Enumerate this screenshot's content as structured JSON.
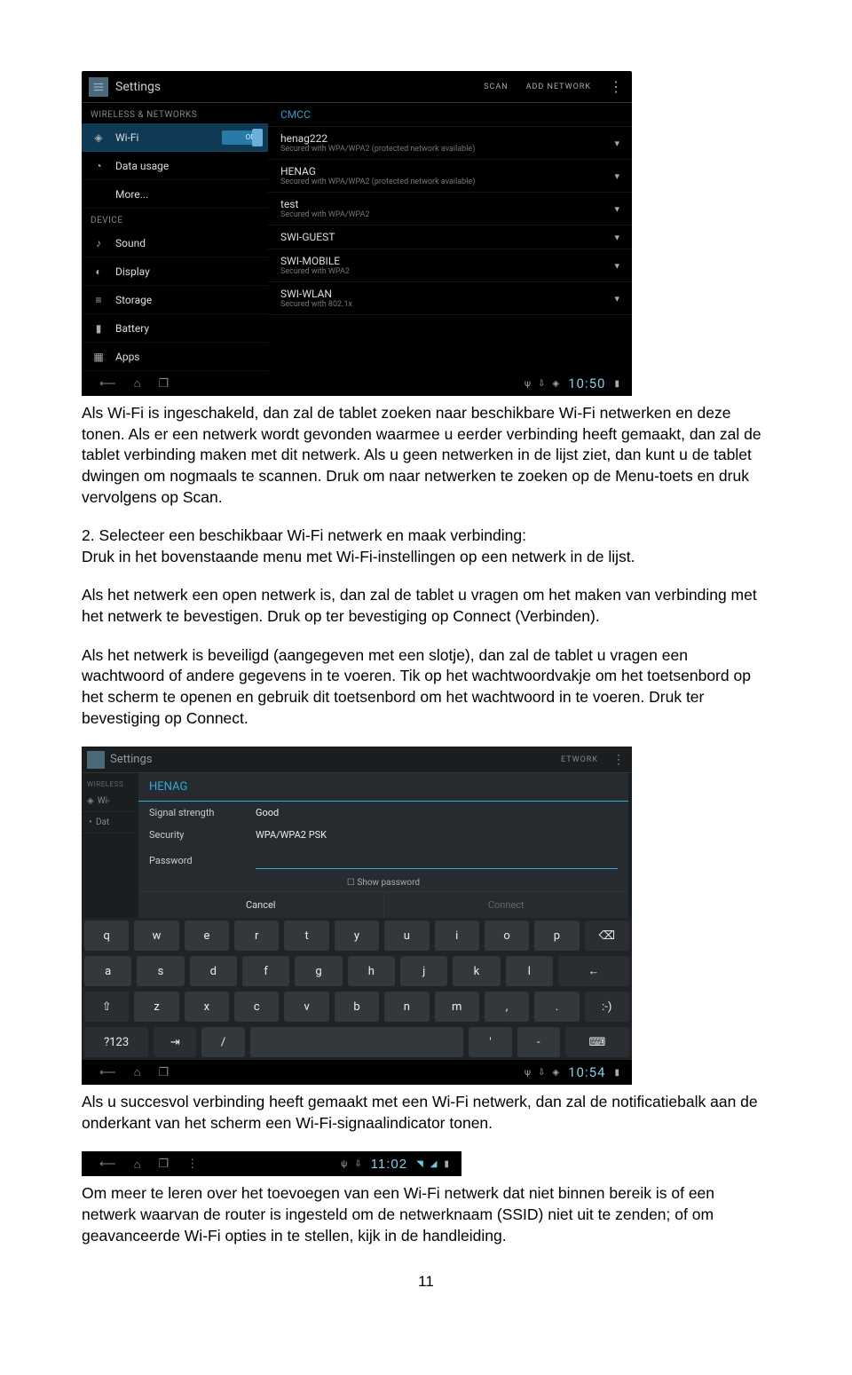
{
  "shot1": {
    "title": "Settings",
    "actions": {
      "scan": "SCAN",
      "add": "ADD NETWORK"
    },
    "cat_wn": "WIRELESS & NETWORKS",
    "cat_dev": "DEVICE",
    "wifi_label": "Wi-Fi",
    "toggle": "ON",
    "data_usage": "Data usage",
    "more": "More...",
    "sound": "Sound",
    "display": "Display",
    "storage": "Storage",
    "battery": "Battery",
    "apps": "Apps",
    "nets": [
      {
        "n": "CMCC",
        "s": ""
      },
      {
        "n": "henag222",
        "s": "Secured with WPA/WPA2 (protected network available)"
      },
      {
        "n": "HENAG",
        "s": "Secured with WPA/WPA2 (protected network available)"
      },
      {
        "n": "test",
        "s": "Secured with WPA/WPA2"
      },
      {
        "n": "SWI-GUEST",
        "s": ""
      },
      {
        "n": "SWI-MOBILE",
        "s": "Secured with WPA2"
      },
      {
        "n": "SWI-WLAN",
        "s": "Secured with 802.1x"
      }
    ],
    "clock": "10:50"
  },
  "shot2": {
    "title": "Settings",
    "rbtn": "ETWORK",
    "cat": "WIRELESS",
    "side_wifi": "Wi-",
    "side_data": "Dat",
    "dialog": {
      "title": "HENAG",
      "strength_lbl": "Signal strength",
      "strength_val": "Good",
      "security_lbl": "Security",
      "security_val": "WPA/WPA2 PSK",
      "password_lbl": "Password",
      "showpw": "Show password",
      "cancel": "Cancel",
      "connect": "Connect"
    },
    "keys_r1": [
      "q",
      "w",
      "e",
      "r",
      "t",
      "y",
      "u",
      "i",
      "o",
      "p",
      "⌫"
    ],
    "keys_r2": [
      "a",
      "s",
      "d",
      "f",
      "g",
      "h",
      "j",
      "k",
      "l",
      "←"
    ],
    "keys_r3": [
      "⇧",
      "z",
      "x",
      "c",
      "v",
      "b",
      "n",
      "m",
      ",",
      ".",
      ":-)"
    ],
    "keys_r4": [
      "?123",
      "⇥",
      "/",
      "",
      "'",
      "-",
      "⌨"
    ],
    "clock": "10:54"
  },
  "shot3": {
    "clock": "11:02"
  },
  "text": {
    "p1": "Als Wi-Fi is ingeschakeld, dan zal de tablet zoeken naar beschikbare Wi-Fi netwerken en deze tonen. Als er een netwerk wordt gevonden waarmee u eerder verbinding heeft gemaakt, dan zal de tablet verbinding maken met dit netwerk. Als u geen netwerken in de lijst ziet, dan kunt u de tablet dwingen om nogmaals te scannen. Druk om naar netwerken te zoeken op de Menu-toets en druk vervolgens op Scan.",
    "p2": "2. Selecteer een beschikbaar Wi-Fi netwerk en maak verbinding:\nDruk in het bovenstaande menu met Wi-Fi-instellingen op een netwerk in de lijst.",
    "p3": "Als het netwerk een open netwerk is, dan zal de tablet u vragen om het maken van verbinding met het netwerk te bevestigen. Druk op ter bevestiging op Connect (Verbinden).",
    "p4": "Als het netwerk is beveiligd (aangegeven met een slotje), dan zal de tablet u vragen een wachtwoord of andere gegevens in te voeren. Tik op het wachtwoordvakje om het toetsenbord op het scherm te openen en gebruik dit toetsenbord om het wachtwoord in te voeren. Druk ter bevestiging op Connect.",
    "p5": "Als u succesvol verbinding heeft gemaakt met een Wi-Fi netwerk, dan zal de notificatiebalk aan de onderkant van het scherm een Wi-Fi-signaalindicator tonen.",
    "p6": "Om meer te leren over het toevoegen van een Wi-Fi netwerk dat niet binnen bereik is of een netwerk waarvan de router is ingesteld om de netwerknaam (SSID) niet uit te zenden; of om geavanceerde Wi-Fi opties in te stellen, kijk in de handleiding.",
    "pagenum": "11"
  }
}
